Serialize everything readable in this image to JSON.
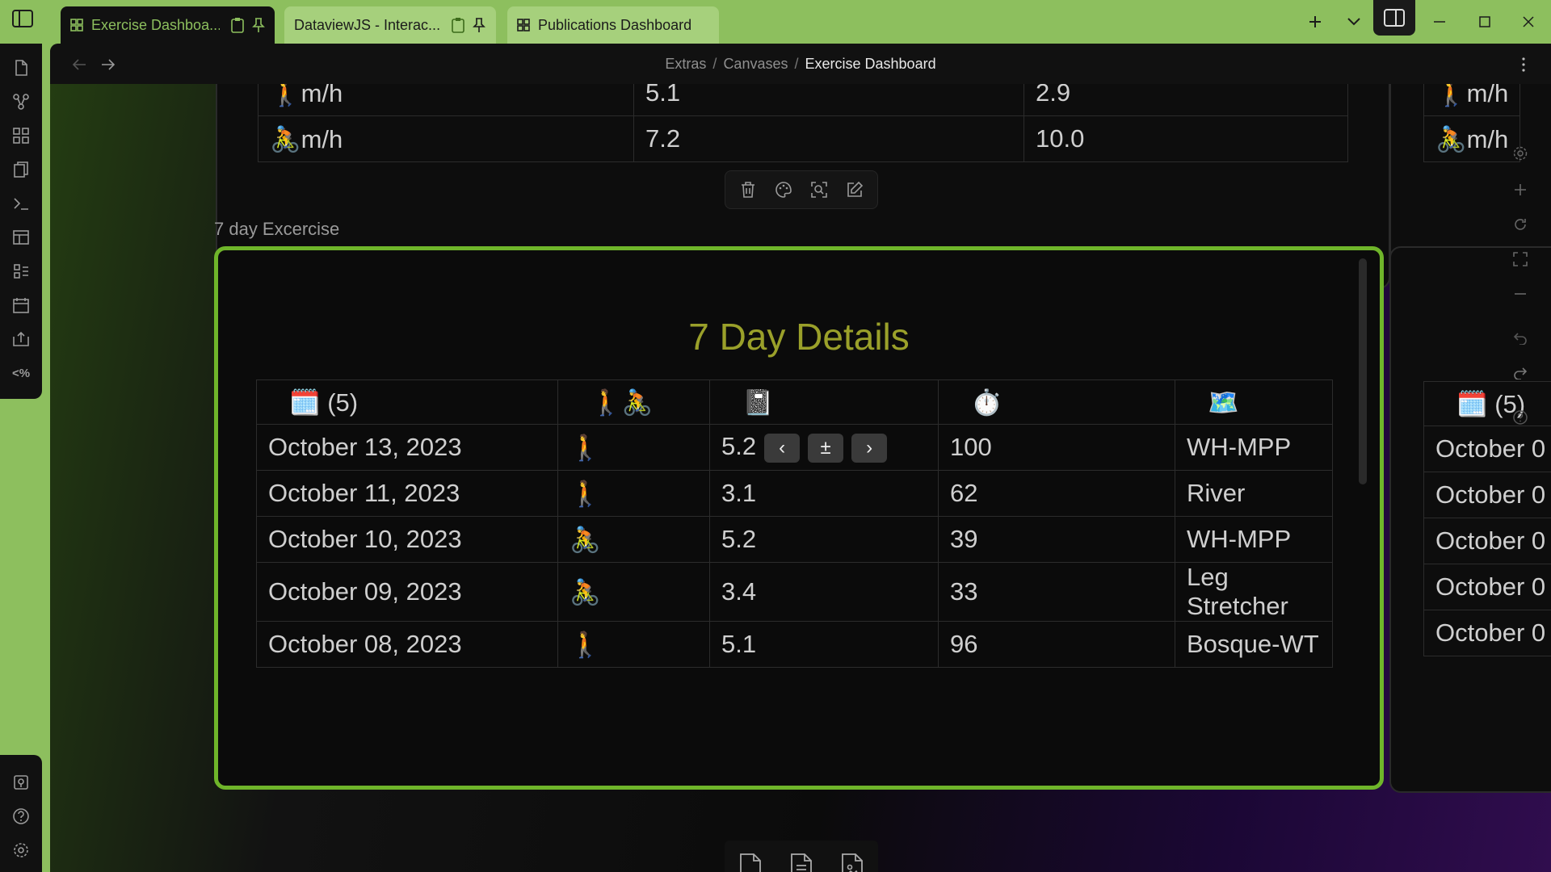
{
  "tabs": [
    {
      "label": "Exercise Dashboa...",
      "active": true,
      "icon": "dashboard-icon"
    },
    {
      "label": "DataviewJS - Interac...",
      "active": false,
      "icon": "file-icon"
    },
    {
      "label": "Publications Dashboard",
      "active": false,
      "icon": "dashboard-icon"
    }
  ],
  "breadcrumb": {
    "parts": [
      "Extras",
      "Canvases"
    ],
    "separator": "/",
    "current": "Exercise Dashboard"
  },
  "top_node": {
    "rows": [
      {
        "label": "🚶m/h",
        "c1": "5.1",
        "c2": "2.9"
      },
      {
        "label": "🚴m/h",
        "c1": "7.2",
        "c2": "10.0"
      }
    ]
  },
  "right_node_top": {
    "rows": [
      "🚶m/h",
      "🚴m/h"
    ]
  },
  "group_label": "7 day Excercise",
  "details": {
    "title": "7 Day Details",
    "headers": [
      "🗓️ (5)",
      "🚶🚴",
      "📓",
      "⏱️",
      "🗺️"
    ],
    "rows": [
      {
        "date": "October 13, 2023",
        "type": "🚶",
        "dist": "5.2",
        "time": "100",
        "route": "WH-MPP"
      },
      {
        "date": "October 11, 2023",
        "type": "🚶",
        "dist": "3.1",
        "time": "62",
        "route": "River"
      },
      {
        "date": "October 10, 2023",
        "type": "🚴",
        "dist": "5.2",
        "time": "39",
        "route": "WH-MPP"
      },
      {
        "date": "October 09, 2023",
        "type": "🚴",
        "dist": "3.4",
        "time": "33",
        "route": "Leg Stretcher"
      },
      {
        "date": "October 08, 2023",
        "type": "🚶",
        "dist": "5.1",
        "time": "96",
        "route": "Bosque-WT"
      }
    ],
    "stepper": {
      "prev": "‹",
      "toggle": "±",
      "next": "›"
    }
  },
  "right_node_details": {
    "header": "🗓️ (5)",
    "rows": [
      "October 0",
      "October 0",
      "October 0",
      "October 0",
      "October 0"
    ]
  },
  "colors": {
    "accent": "#6fb52a",
    "title": "#9aa02a",
    "titlebar": "#8dbf5e"
  }
}
